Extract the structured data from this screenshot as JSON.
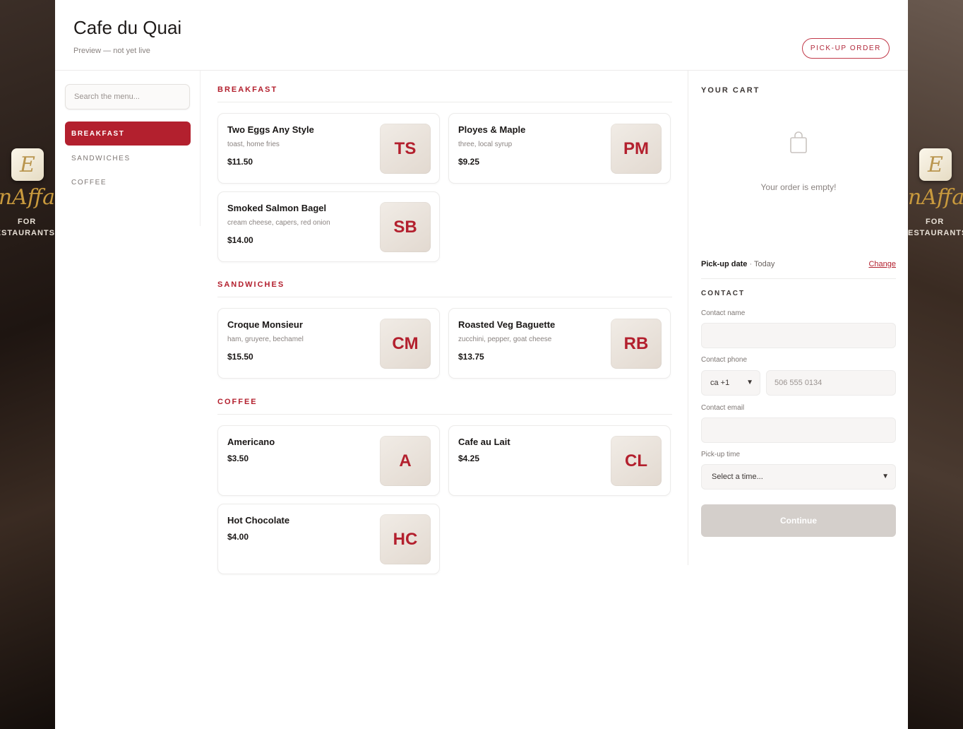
{
  "brand": {
    "badge_letter": "E",
    "script_left": "nAffa",
    "script_right": "nAffa",
    "for": "FOR",
    "restaurants_left": "ESTAURANTS",
    "restaurants_right": "ESTAURANTS"
  },
  "header": {
    "title": "Cafe du Quai",
    "subtitle": "Preview — not yet live",
    "mode_button": "PICK-UP ORDER"
  },
  "sidebar": {
    "search_placeholder": "Search the menu...",
    "categories": [
      {
        "label": "BREAKFAST",
        "active": true
      },
      {
        "label": "SANDWICHES",
        "active": false
      },
      {
        "label": "COFFEE",
        "active": false
      }
    ]
  },
  "menu": {
    "sections": [
      {
        "title": "BREAKFAST",
        "items": [
          {
            "name": "Two Eggs Any Style",
            "desc": "toast, home fries",
            "price": "$11.50",
            "initials": "TS"
          },
          {
            "name": "Ployes & Maple",
            "desc": "three, local syrup",
            "price": "$9.25",
            "initials": "PM"
          },
          {
            "name": "Smoked Salmon Bagel",
            "desc": "cream cheese, capers, red onion",
            "price": "$14.00",
            "initials": "SB"
          }
        ]
      },
      {
        "title": "SANDWICHES",
        "items": [
          {
            "name": "Croque Monsieur",
            "desc": "ham, gruyere, bechamel",
            "price": "$15.50",
            "initials": "CM"
          },
          {
            "name": "Roasted Veg Baguette",
            "desc": "zucchini, pepper, goat cheese",
            "price": "$13.75",
            "initials": "RB"
          }
        ]
      },
      {
        "title": "COFFEE",
        "items": [
          {
            "name": "Americano",
            "desc": "",
            "price": "$3.50",
            "initials": "A"
          },
          {
            "name": "Cafe au Lait",
            "desc": "",
            "price": "$4.25",
            "initials": "CL"
          },
          {
            "name": "Hot Chocolate",
            "desc": "",
            "price": "$4.00",
            "initials": "HC"
          }
        ]
      }
    ]
  },
  "cart": {
    "title": "YOUR CART",
    "empty_text": "Your order is empty!",
    "pickup_label": "Pick-up date",
    "pickup_sep": "·",
    "pickup_value": "Today",
    "change_link": "Change",
    "contact_title": "CONTACT",
    "name_label": "Contact name",
    "phone_label": "Contact phone",
    "country_value": "ca +1",
    "phone_placeholder": "506 555 0134",
    "email_label": "Contact email",
    "time_label": "Pick-up time",
    "time_value": "Select a time...",
    "continue_button": "Continue"
  },
  "colors": {
    "accent": "#b3202e",
    "disabled_button": "#d4cfcb"
  }
}
